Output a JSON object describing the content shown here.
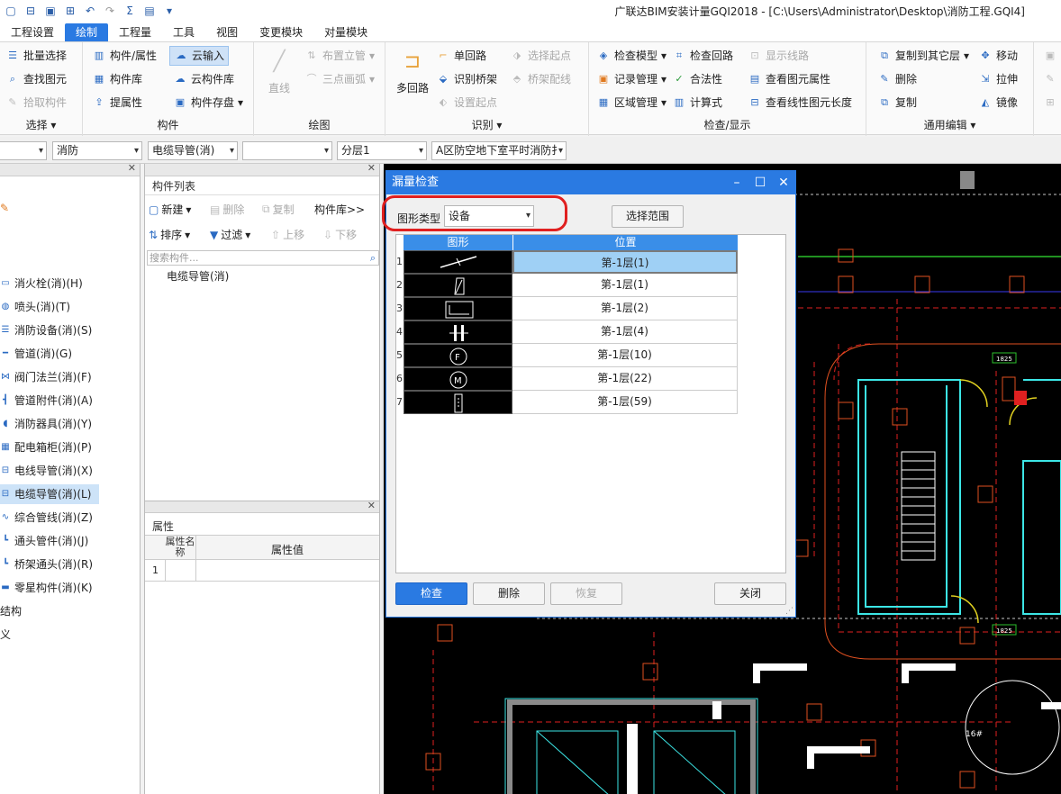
{
  "window": {
    "title": "广联达BIM安装计量GQI2018 - [C:\\Users\\Administrator\\Desktop\\消防工程.GQI4]"
  },
  "quick_access": {
    "icons": [
      "new-file-icon",
      "open-folder-icon",
      "save-icon",
      "hub-icon",
      "undo-icon",
      "redo-icon",
      "sum-icon",
      "save-as-icon",
      "customize-icon"
    ]
  },
  "menu": {
    "items": [
      "工程设置",
      "绘制",
      "工程量",
      "工具",
      "视图",
      "变更模块",
      "对量模块"
    ],
    "active": "绘制"
  },
  "ribbon": {
    "select_group": {
      "label": "选择",
      "batch_select": "批量选择",
      "find_element": "查找图元",
      "pick_component": "拾取构件"
    },
    "component_group": {
      "label": "构件",
      "comp_attr": "构件/属性",
      "cloud_input": "云输入",
      "comp_lib": "构件库",
      "cloud_lib": "云构件库",
      "extract_attr": "提属性",
      "comp_save": "构件存盘"
    },
    "draw_group": {
      "label": "绘图",
      "line": "直线",
      "place_riser": "布置立管",
      "three_point_arc": "三点画弧"
    },
    "identify_group": {
      "label": "识别",
      "multi_loop": "多回路",
      "single_loop": "单回路",
      "select_start": "选择起点",
      "identify_tray": "识别桥架",
      "tray_wiring": "桥架配线",
      "set_start": "设置起点"
    },
    "check_group": {
      "label": "检查/显示",
      "check_model": "检查模型",
      "check_loop": "检查回路",
      "show_routes": "显示线路",
      "record_mgmt": "记录管理",
      "legality": "合法性",
      "view_elem_attr": "查看图元属性",
      "zone_mgmt": "区域管理",
      "formula": "计算式",
      "view_linear_len": "查看线性图元长度"
    },
    "edit_group": {
      "label": "通用编辑",
      "copy_to_other": "复制到其它层",
      "move": "移动",
      "delete": "删除",
      "stretch": "拉伸",
      "copy": "复制",
      "mirror": "镜像"
    }
  },
  "filter_bar": {
    "combo1": "",
    "discipline": "消防",
    "category": "电缆导管(消)",
    "combo4": "",
    "layer": "分层1",
    "drawing": "A区防空地下室平时消防扌"
  },
  "left_tree": {
    "items": [
      {
        "label": "消火栓(消)(H)",
        "icon": "hydrant-icon",
        "selected": false
      },
      {
        "label": "喷头(消)(T)",
        "icon": "sprinkler-icon",
        "selected": false
      },
      {
        "label": "消防设备(消)(S)",
        "icon": "fire-equipment-icon",
        "selected": false
      },
      {
        "label": "管道(消)(G)",
        "icon": "pipe-icon",
        "selected": false
      },
      {
        "label": "阀门法兰(消)(F)",
        "icon": "valve-icon",
        "selected": false
      },
      {
        "label": "管道附件(消)(A)",
        "icon": "pipe-fitting-icon",
        "selected": false
      },
      {
        "label": "消防器具(消)(Y)",
        "icon": "fire-appliance-icon",
        "selected": false
      },
      {
        "label": "配电箱柜(消)(P)",
        "icon": "distribution-box-icon",
        "selected": false
      },
      {
        "label": "电线导管(消)(X)",
        "icon": "wire-conduit-icon",
        "selected": false
      },
      {
        "label": "电缆导管(消)(L)",
        "icon": "cable-conduit-icon",
        "selected": true
      },
      {
        "label": "综合管线(消)(Z)",
        "icon": "combined-line-icon",
        "selected": false
      },
      {
        "label": "通头管件(消)(J)",
        "icon": "tee-fitting-icon",
        "selected": false
      },
      {
        "label": "桥架通头(消)(R)",
        "icon": "tray-tee-icon",
        "selected": false
      },
      {
        "label": "零星构件(消)(K)",
        "icon": "misc-component-icon",
        "selected": false
      }
    ],
    "extra": [
      "结构",
      "义"
    ]
  },
  "component_list": {
    "title": "构件列表",
    "new": "新建",
    "delete": "删除",
    "copy": "复制",
    "library": "构件库>>",
    "sort": "排序",
    "filter": "过滤",
    "move_up": "上移",
    "move_down": "下移",
    "search_placeholder": "搜索构件...",
    "items": [
      "电缆导管(消)"
    ]
  },
  "properties": {
    "title": "属性",
    "col_name": "属性名称",
    "col_value": "属性值",
    "rows": [
      {
        "num": "1",
        "name": "",
        "value": ""
      }
    ]
  },
  "dialog": {
    "title": "漏量检查",
    "shape_type_label": "图形类型",
    "shape_type_value": "设备",
    "select_range": "选择范围",
    "col_shape": "图形",
    "col_position": "位置",
    "rows": [
      {
        "num": "1",
        "shape": "diagonal-line-symbol",
        "position": "第-1层(1)",
        "selected": true
      },
      {
        "num": "2",
        "shape": "slanted-box-symbol",
        "position": "第-1层(1)",
        "selected": false
      },
      {
        "num": "3",
        "shape": "panel-box-symbol",
        "position": "第-1层(2)",
        "selected": false
      },
      {
        "num": "4",
        "shape": "double-bar-symbol",
        "position": "第-1层(4)",
        "selected": false
      },
      {
        "num": "5",
        "shape": "circle-f-symbol",
        "position": "第-1层(10)",
        "selected": false
      },
      {
        "num": "6",
        "shape": "circle-m-symbol",
        "position": "第-1层(22)",
        "selected": false
      },
      {
        "num": "7",
        "shape": "small-rect-symbol",
        "position": "第-1层(59)",
        "selected": false
      }
    ],
    "check": "检查",
    "delete": "删除",
    "restore": "恢复",
    "close": "关闭"
  },
  "cad": {
    "labels": [
      "1825",
      "1825",
      "16#"
    ]
  },
  "colors": {
    "accent": "#2a7ae2",
    "highlight_box": "#e02020",
    "selected_row": "#9fd0f5",
    "canvas_bg": "#000000"
  }
}
